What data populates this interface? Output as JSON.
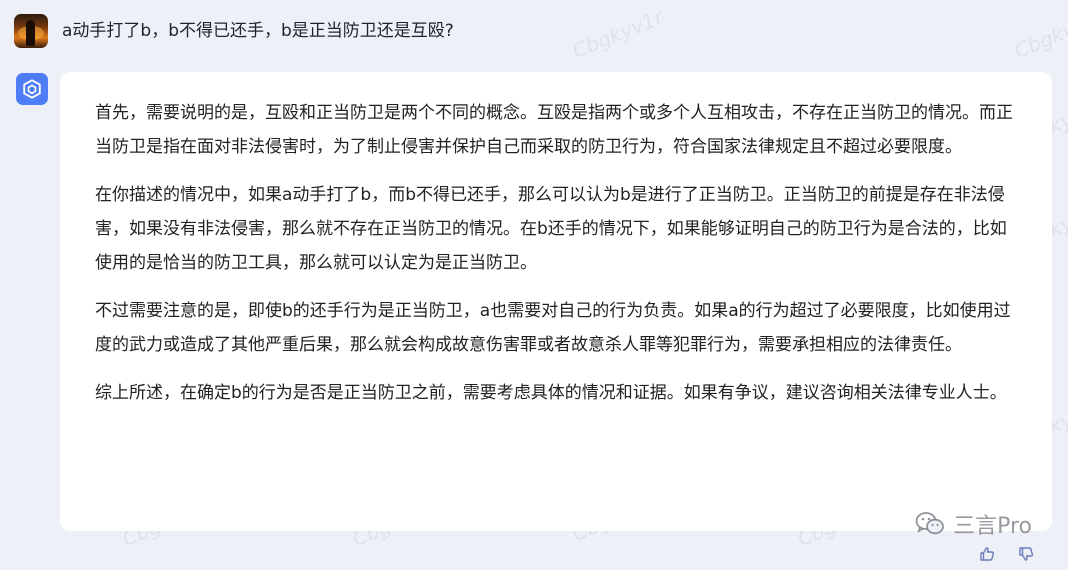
{
  "user": {
    "question": "a动手打了b，b不得已还手，b是正当防卫还是互殴?"
  },
  "answer": {
    "paragraphs": [
      "首先，需要说明的是，互殴和正当防卫是两个不同的概念。互殴是指两个或多个人互相攻击，不存在正当防卫的情况。而正当防卫是指在面对非法侵害时，为了制止侵害并保护自己而采取的防卫行为，符合国家法律规定且不超过必要限度。",
      "在你描述的情况中，如果a动手打了b，而b不得已还手，那么可以认为b是进行了正当防卫。正当防卫的前提是存在非法侵害，如果没有非法侵害，那么就不存在正当防卫的情况。在b还手的情况下，如果能够证明自己的防卫行为是合法的，比如使用的是恰当的防卫工具，那么就可以认定为是正当防卫。",
      "不过需要注意的是，即使b的还手行为是正当防卫，a也需要对自己的行为负责。如果a的行为超过了必要限度，比如使用过度的武力或造成了其他严重后果，那么就会构成故意伤害罪或者故意杀人罪等犯罪行为，需要承担相应的法律责任。",
      "综上所述，在确定b的行为是否是正当防卫之前，需要考虑具体的情况和证据。如果有争议，建议咨询相关法律专业人士。"
    ]
  },
  "watermark": {
    "text": "Cbgkyv1r",
    "brand": "三言Pro"
  },
  "icons": {
    "user_avatar": "user-avatar-photo",
    "bot_avatar": "cube-logo-icon",
    "like": "thumbs-up-icon",
    "dislike": "thumbs-down-icon",
    "brand": "wechat-icon"
  },
  "colors": {
    "background": "#eef0f7",
    "card": "#ffffff",
    "bot_accent": "#4e7df5"
  }
}
